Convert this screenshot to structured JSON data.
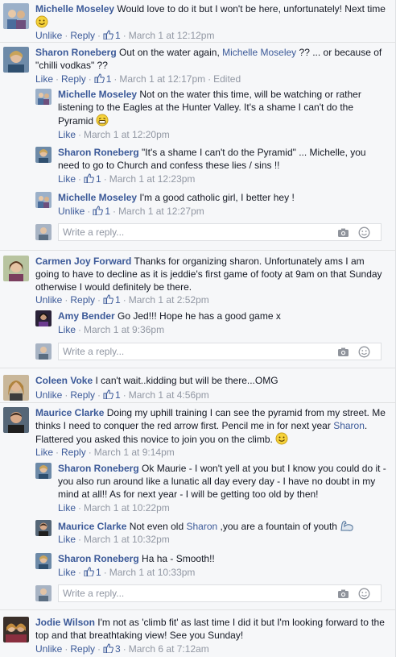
{
  "actions": {
    "like": "Like",
    "unlike": "Unlike",
    "reply": "Reply",
    "edited": "Edited",
    "sep": "·"
  },
  "reply_placeholder": "Write a reply...",
  "comments": {
    "c1": {
      "name": "Michelle Moseley",
      "text": "Would love to do it but I won't be here, unfortunately! Next time",
      "likes": "1",
      "time": "March 1 at 12:12pm"
    },
    "c2": {
      "name": "Sharon Roneberg",
      "text_a": "Out on the water again,",
      "mention": "Michelle Moseley",
      "text_b": "?? ... or because of \"chilli vodkas\" ??",
      "likes": "1",
      "time": "March 1 at 12:17pm"
    },
    "r1": {
      "name": "Michelle Moseley",
      "text": "Not on the water this time, will be watching or rather listening to the Eagles at the Hunter Valley. It's a shame I can't do the Pyramid",
      "time": "March 1 at 12:20pm"
    },
    "r2": {
      "name": "Sharon Roneberg",
      "text": "\"It's a shame I can't do the Pyramid\" ... Michelle, you need to go to Church and confess these lies / sins !!",
      "likes": "1",
      "time": "March 1 at 12:23pm"
    },
    "r3": {
      "name": "Michelle Moseley",
      "text": "I'm a good catholic girl, I better hey !",
      "likes": "1",
      "time": "March 1 at 12:27pm"
    },
    "c3": {
      "name": "Carmen Joy Forward",
      "text": "Thanks for organizing sharon. Unfortunately ams I am going to have to decline as it is jeddie's first game of footy at 9am on that Sunday otherwise I would definitely be there.",
      "likes": "1",
      "time": "March 1 at 2:52pm"
    },
    "r4": {
      "name": "Amy Bender",
      "text": "Go Jed!!! Hope he has a good game x",
      "time": "March 1 at 9:36pm"
    },
    "c4": {
      "name": "Coleen Voke",
      "text": "I can't wait..kidding but will be there...OMG",
      "likes": "1",
      "time": "March 1 at 4:56pm"
    },
    "c5": {
      "name": "Maurice Clarke",
      "text_a": "Doing my uphill training I can see the pyramid from my street. Me thinks I need to conquer the red arrow first. Pencil me in for next year",
      "mention": "Sharon",
      "text_b": ". Flattered you asked this novice to join you on the climb.",
      "time": "March 1 at 9:14pm"
    },
    "r5": {
      "name": "Sharon Roneberg",
      "text": "Ok Maurie - I won't yell at you but I know you could do it - you also run around like a lunatic all day every day - I have no doubt in my mind at all!! As for next year - I will be getting too old by then!",
      "time": "March 1 at 10:22pm"
    },
    "r6": {
      "name": "Maurice Clarke",
      "text_a": "Not even old",
      "mention": "Sharon",
      "text_b": ",you are a fountain of youth",
      "time": "March 1 at 10:32pm"
    },
    "r7": {
      "name": "Sharon Roneberg",
      "text": "Ha ha - Smooth!!",
      "likes": "1",
      "time": "March 1 at 10:33pm"
    },
    "c6": {
      "name": "Jodie Wilson",
      "text": "I'm not as 'climb fit' as last time I did it but I'm looking forward to the top and that breathtaking view! See you Sunday!",
      "likes": "3",
      "time": "March 6 at 7:12am"
    }
  },
  "colors": {
    "link": "#3b5998",
    "meta": "#9197a3",
    "text": "#141823",
    "background": "#f6f7f9"
  }
}
